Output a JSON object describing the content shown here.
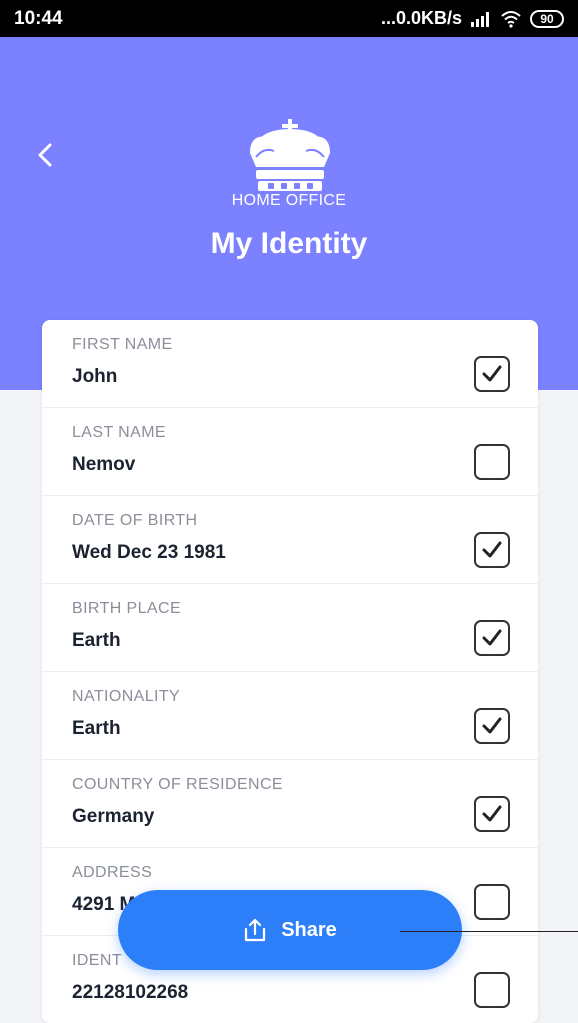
{
  "status_bar": {
    "time": "10:44",
    "network": "...0.0KB/s",
    "battery": "90",
    "icons": [
      "signal-icon",
      "wifi-icon",
      "battery-icon"
    ]
  },
  "header": {
    "back_icon": "chevron-left-icon",
    "logo_icon": "crown-icon",
    "subtitle": "HOME OFFICE",
    "title": "My Identity",
    "background": "#7b81ff"
  },
  "fields": [
    {
      "label": "FIRST NAME",
      "value": "John",
      "checked": true
    },
    {
      "label": "LAST NAME",
      "value": "Nemov",
      "checked": false
    },
    {
      "label": "DATE OF BIRTH",
      "value": "Wed Dec 23 1981",
      "checked": true
    },
    {
      "label": "BIRTH PLACE",
      "value": "Earth",
      "checked": true
    },
    {
      "label": "NATIONALITY",
      "value": "Earth",
      "checked": true
    },
    {
      "label": "COUNTRY OF RESIDENCE",
      "value": "Germany",
      "checked": true
    },
    {
      "label": "ADDRESS",
      "value": "4291 M",
      "checked": false
    },
    {
      "label": "IDENT",
      "value": "22128102268",
      "checked": false
    }
  ],
  "share": {
    "label": "Share",
    "icon": "share-upload-icon",
    "color": "#2d7ff9"
  }
}
